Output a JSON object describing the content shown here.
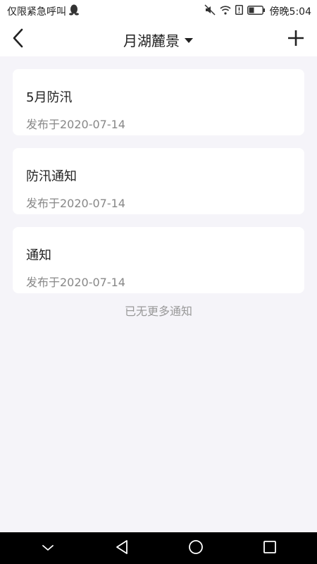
{
  "status_bar": {
    "left_text": "仅限紧急呼叫",
    "time": "傍晚5:04",
    "icons": [
      "qq-penguin-icon",
      "mute-icon",
      "wifi-icon",
      "alert-icon",
      "battery-icon"
    ]
  },
  "header": {
    "title": "月湖麓景",
    "icons": {
      "back": "back-chevron-icon",
      "dropdown": "caret-down-icon",
      "add": "plus-icon"
    }
  },
  "notices": [
    {
      "title": "5月防汛",
      "date": "发布于2020-07-14"
    },
    {
      "title": "防汛通知",
      "date": "发布于2020-07-14"
    },
    {
      "title": "通知",
      "date": "发布于2020-07-14"
    }
  ],
  "footer_text": "已无更多通知",
  "nav_bar": {
    "icons": [
      "collapse-icon",
      "nav-back-icon",
      "home-icon",
      "recents-icon"
    ]
  },
  "colors": {
    "background": "#f5f4f9",
    "card": "#ffffff",
    "primary_text": "#222222",
    "secondary_text": "#888888",
    "nav_bar": "#000000"
  }
}
